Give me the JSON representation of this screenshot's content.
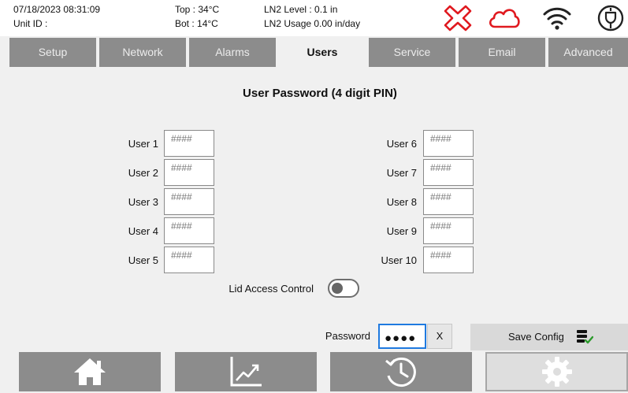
{
  "status": {
    "datetime": "07/18/2023 08:31:09",
    "unit_id": "Unit ID :",
    "top_temp": "Top : 34°C",
    "bot_temp": "Bot : 14°C",
    "ln2_level": "LN2 Level : 0.1 in",
    "ln2_usage": "LN2 Usage  0.00 in/day",
    "icons": [
      "alarm-x-icon",
      "cloud-icon",
      "wifi-icon",
      "power-plug-icon"
    ],
    "colors": {
      "alarm": "#e0191f",
      "cloud": "#e0191f"
    }
  },
  "tabs": [
    {
      "label": "Setup"
    },
    {
      "label": "Network"
    },
    {
      "label": "Alarms"
    },
    {
      "label": "Users",
      "active": true
    },
    {
      "label": "Service"
    },
    {
      "label": "Email"
    },
    {
      "label": "Advanced"
    }
  ],
  "main": {
    "title": "User Password (4 digit PIN)",
    "users_left": [
      {
        "label": "User 1",
        "placeholder": "####"
      },
      {
        "label": "User 2",
        "placeholder": "####"
      },
      {
        "label": "User 3",
        "placeholder": "####"
      },
      {
        "label": "User 4",
        "placeholder": "####"
      },
      {
        "label": "User 5",
        "placeholder": "####"
      }
    ],
    "users_right": [
      {
        "label": "User 6",
        "placeholder": "####"
      },
      {
        "label": "User 7",
        "placeholder": "####"
      },
      {
        "label": "User 8",
        "placeholder": "####"
      },
      {
        "label": "User 9",
        "placeholder": "####"
      },
      {
        "label": "User 10",
        "placeholder": "####"
      }
    ],
    "lid_access_label": "Lid Access Control",
    "lid_access_on": false
  },
  "footer": {
    "password_label": "Password",
    "password_value": "●●●●",
    "clear_label": "X",
    "save_label": "Save Config",
    "nav": [
      "home-icon",
      "chart-icon",
      "history-icon",
      "settings-gear-icon"
    ],
    "nav_active": "settings-gear-icon"
  }
}
